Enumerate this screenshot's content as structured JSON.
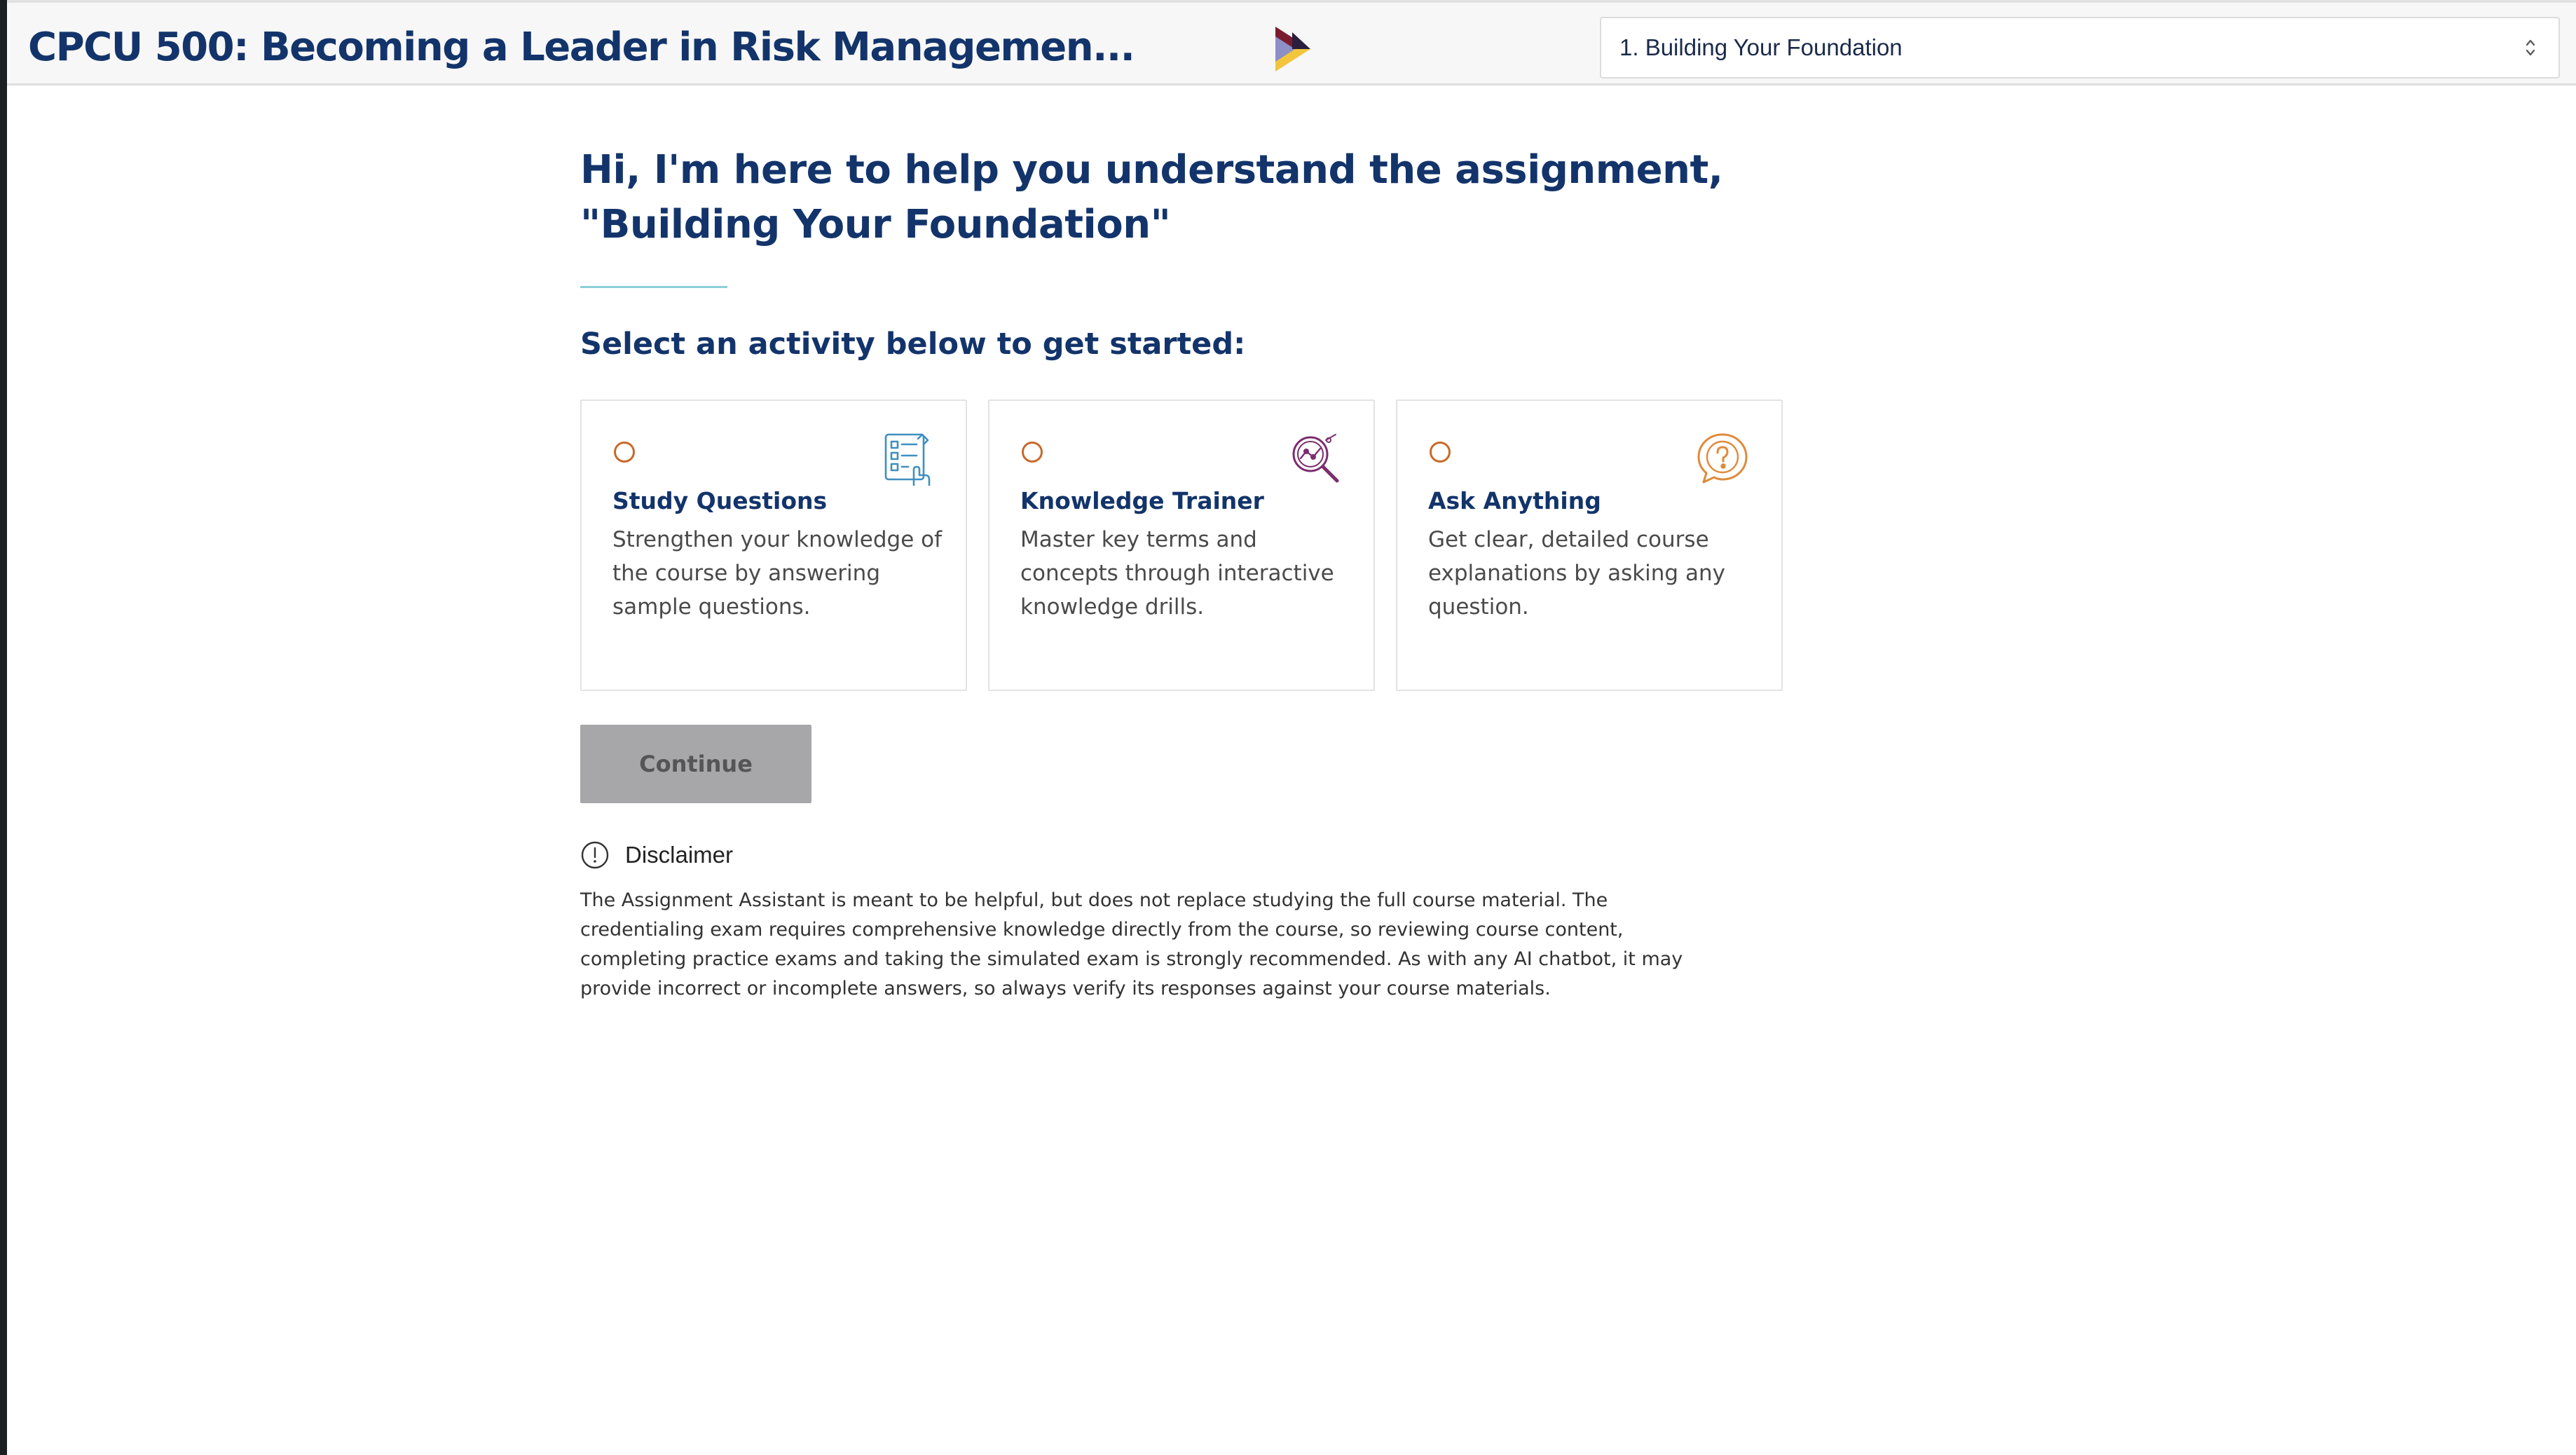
{
  "header": {
    "course_title": "CPCU 500: Becoming a Leader in Risk Managemen...",
    "logo_icon": "brand-triangle-logo",
    "assignment_select": {
      "selected": "1. Building Your Foundation"
    }
  },
  "main": {
    "greeting_line1": "Hi, I'm here to help you understand the assignment,",
    "greeting_line2": "\"Building Your Foundation\"",
    "prompt": "Select an activity below to get started:",
    "activities": [
      {
        "title": "Study Questions",
        "description": "Strengthen your knowledge of the course by answering sample questions.",
        "icon": "checklist-icon",
        "icon_color": "#3f8fc0"
      },
      {
        "title": "Knowledge Trainer",
        "description": "Master key terms and concepts through interactive knowledge drills.",
        "icon": "magnifier-graph-icon",
        "icon_color": "#7b2e6e"
      },
      {
        "title": "Ask Anything",
        "description": "Get clear, detailed course explanations by asking any question.",
        "icon": "question-bubble-icon",
        "icon_color": "#e08a3a"
      }
    ],
    "continue_label": "Continue",
    "disclaimer": {
      "label": "Disclaimer",
      "icon": "info-circle-icon",
      "text": "The Assignment Assistant is meant to be helpful, but does not replace studying the full course material. The credentialing exam requires comprehensive knowledge directly from the course, so reviewing course content, completing practice exams and taking the simulated exam is strongly recommended. As with any AI chatbot, it may provide incorrect or incomplete answers, so always verify its responses against your course materials."
    }
  },
  "colors": {
    "primary_navy": "#13346b",
    "radio_orange": "#c8692a",
    "divider_teal": "#8ccfd8",
    "button_disabled": "#a7a7aa"
  }
}
